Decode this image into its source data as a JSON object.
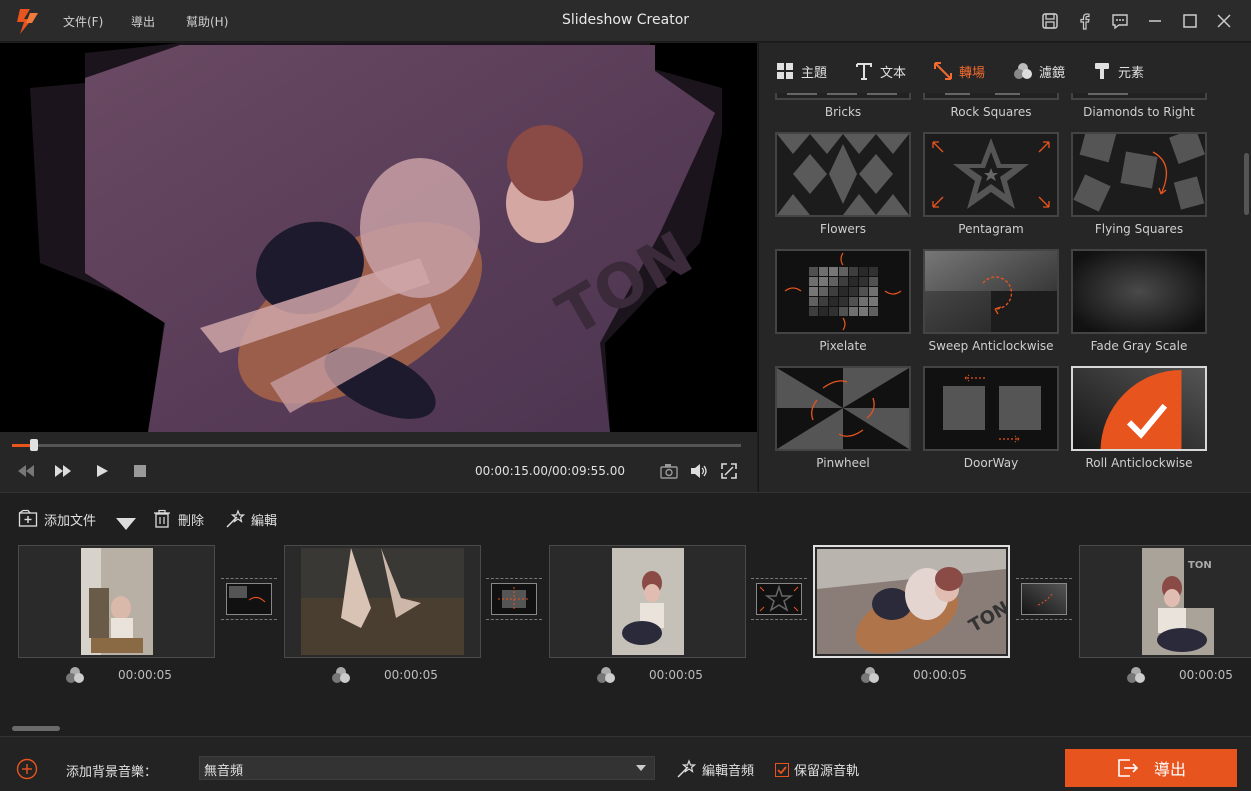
{
  "app": {
    "title": "Slideshow Creator"
  },
  "menu": [
    "文件(F)",
    "導出",
    "幫助(H)"
  ],
  "player": {
    "time": "00:00:15.00/00:09:55.00",
    "progress": 0.03
  },
  "tabs": [
    {
      "label": "主題",
      "icon": "theme-icon"
    },
    {
      "label": "文本",
      "icon": "text-icon"
    },
    {
      "label": "轉場",
      "icon": "transition-icon",
      "active": true
    },
    {
      "label": "濾鏡",
      "icon": "filter-icon"
    },
    {
      "label": "元素",
      "icon": "element-icon"
    }
  ],
  "transitions": {
    "row0": [
      "Bricks",
      "Rock Squares",
      "Diamonds to Right"
    ],
    "row1": [
      "Flowers",
      "Pentagram",
      "Flying Squares"
    ],
    "row2": [
      "Pixelate",
      "Sweep Anticlockwise",
      "Fade Gray Scale"
    ],
    "row3": [
      "Pinwheel",
      "DoorWay",
      "Roll Anticlockwise"
    ],
    "selected": "Roll Anticlockwise"
  },
  "toolbar": {
    "add_file": "添加文件",
    "delete": "刪除",
    "edit": "編輯"
  },
  "clips": [
    {
      "duration": "00:00:05"
    },
    {
      "duration": "00:00:05"
    },
    {
      "duration": "00:00:05"
    },
    {
      "duration": "00:00:05"
    },
    {
      "duration": "00:00:05"
    }
  ],
  "bottom": {
    "music_label": "添加背景音樂：",
    "music_value": "無音頻",
    "edit_audio": "編輯音頻",
    "keep_audio": "保留源音軌",
    "export": "導出"
  },
  "colors": {
    "accent": "#e8541e",
    "panel": "#262626",
    "background": "#1e1e1e"
  }
}
